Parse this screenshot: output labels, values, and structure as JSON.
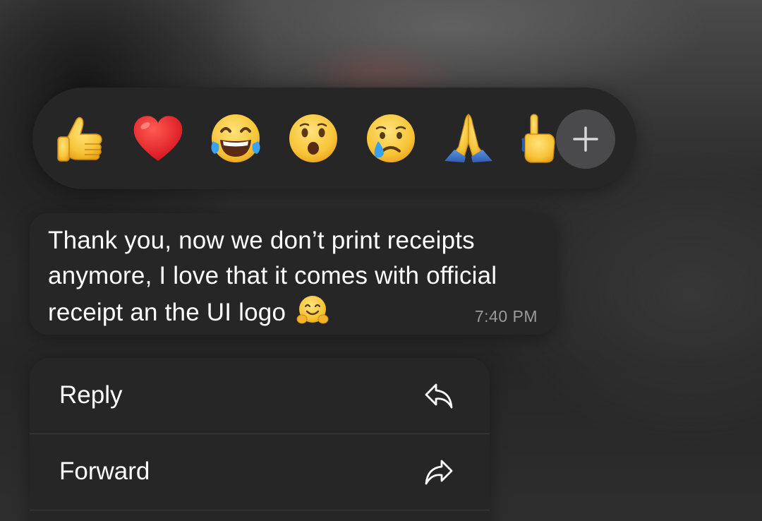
{
  "reactions": {
    "items": [
      {
        "name": "thumbs-up",
        "glyph": "👍"
      },
      {
        "name": "red-heart",
        "glyph": "❤️"
      },
      {
        "name": "tears-of-joy",
        "glyph": "😂"
      },
      {
        "name": "face-open-mouth",
        "glyph": "😮"
      },
      {
        "name": "crying-face",
        "glyph": "😢"
      },
      {
        "name": "folded-hands",
        "glyph": "🙏"
      },
      {
        "name": "partially-visible-hand",
        "glyph": "🖕"
      }
    ],
    "more_icon": "plus-icon"
  },
  "message": {
    "text": "Thank you, now we don’t print receipts anymore, I love that it comes with official receipt an the UI logo",
    "trailing_emoji": "hugging-face",
    "time": "7:40 PM"
  },
  "menu": {
    "items": [
      {
        "label": "Reply",
        "icon": "reply-icon"
      },
      {
        "label": "Forward",
        "icon": "forward-icon"
      }
    ]
  },
  "colors": {
    "panel": "#262626",
    "plus_button": "#4a4a4c",
    "text": "#ffffff",
    "time": "#9a9a9a",
    "emoji_yellow": "#f9c43a"
  }
}
